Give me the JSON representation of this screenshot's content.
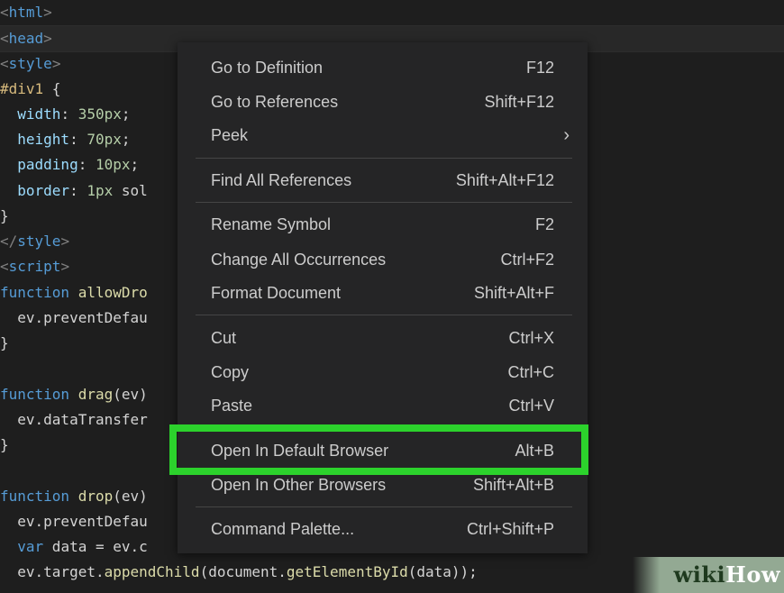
{
  "code": {
    "line1": {
      "lt": "<",
      "tag": "html",
      "gt": ">"
    },
    "line2": {
      "lt": "<",
      "tag": "head",
      "gt": ">"
    },
    "line3": {
      "lt": "<",
      "tag": "style",
      "gt": ">"
    },
    "line4": {
      "selector": "#div1",
      "brace": " {"
    },
    "line5": {
      "prop": "width",
      "sep": ": ",
      "val": "350px",
      "end": ";"
    },
    "line6": {
      "prop": "height",
      "sep": ": ",
      "val": "70px",
      "end": ";"
    },
    "line7": {
      "prop": "padding",
      "sep": ": ",
      "val": "10px",
      "end": ";"
    },
    "line8": {
      "prop": "border",
      "sep": ": ",
      "val": "1px",
      "rest": " sol"
    },
    "line9": {
      "text": "}"
    },
    "line10": {
      "lt": "</",
      "tag": "style",
      "gt": ">"
    },
    "line11": {
      "lt": "<",
      "tag": "script",
      "gt": ">"
    },
    "line12": {
      "kw": "function",
      "name": " allowDro"
    },
    "line13": {
      "text": "  ev.preventDefau"
    },
    "line14": {
      "text": "}"
    },
    "line16": {
      "kw": "function",
      "name": " drag",
      "args": "(ev)"
    },
    "line17": {
      "text": "  ev.dataTransfer"
    },
    "line18": {
      "text": "}"
    },
    "line20": {
      "kw": "function",
      "name": " drop",
      "args": "(ev)"
    },
    "line21": {
      "text": "  ev.preventDefau"
    },
    "line22": {
      "kw": "  var",
      "text": " data = ev.c"
    },
    "line23": {
      "pre": "  ev.target.",
      "fn1": "appendChild",
      "mid": "(document.",
      "fn2": "getElementById",
      "post": "(data));"
    }
  },
  "context_menu": {
    "items": [
      {
        "label": "Go to Definition",
        "shortcut": "F12"
      },
      {
        "label": "Go to References",
        "shortcut": "Shift+F12"
      },
      {
        "label": "Peek",
        "shortcut": ""
      },
      {
        "label": "Find All References",
        "shortcut": "Shift+Alt+F12"
      },
      {
        "label": "Rename Symbol",
        "shortcut": "F2"
      },
      {
        "label": "Change All Occurrences",
        "shortcut": "Ctrl+F2"
      },
      {
        "label": "Format Document",
        "shortcut": "Shift+Alt+F"
      },
      {
        "label": "Cut",
        "shortcut": "Ctrl+X"
      },
      {
        "label": "Copy",
        "shortcut": "Ctrl+C"
      },
      {
        "label": "Paste",
        "shortcut": "Ctrl+V"
      },
      {
        "label": "Open In Default Browser",
        "shortcut": "Alt+B"
      },
      {
        "label": "Open In Other Browsers",
        "shortcut": "Shift+Alt+B"
      },
      {
        "label": "Command Palette...",
        "shortcut": "Ctrl+Shift+P"
      }
    ],
    "peek_chevron": "›",
    "highlighted_item": "Open In Default Browser",
    "highlight_color": "#2cd22c"
  },
  "watermark": {
    "wiki": "wiki",
    "how": "How"
  }
}
